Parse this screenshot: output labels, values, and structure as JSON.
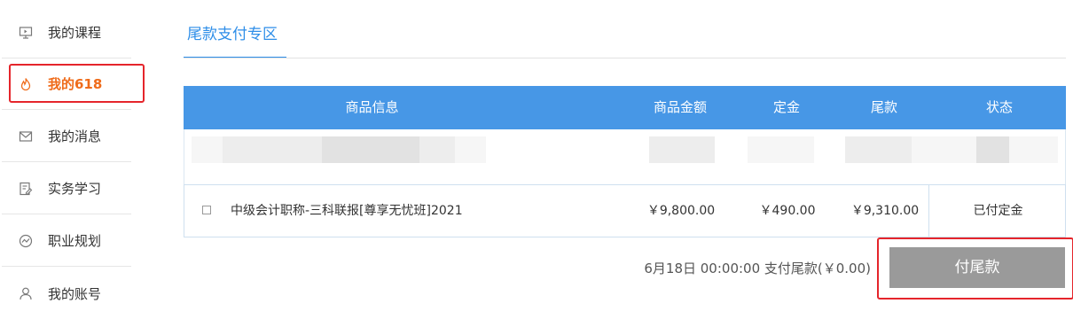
{
  "sidebar": {
    "items": [
      {
        "label": "我的课程",
        "icon": "monitor-icon"
      },
      {
        "label": "我的618",
        "icon": "flame-icon",
        "active": true
      },
      {
        "label": "我的消息",
        "icon": "mail-icon"
      },
      {
        "label": "实务学习",
        "icon": "edit-doc-icon"
      },
      {
        "label": "职业规划",
        "icon": "trend-circle-icon"
      },
      {
        "label": "我的账号",
        "icon": "user-icon"
      }
    ]
  },
  "tabs": [
    {
      "label": "尾款支付专区"
    }
  ],
  "table": {
    "headers": [
      "商品信息",
      "商品金额",
      "定金",
      "尾款",
      "状态"
    ],
    "rows": [
      {
        "name": "中级会计职称-三科联报[尊享无忧班]2021",
        "price": "￥9,800.00",
        "deposit": "￥490.00",
        "balance": "￥9,310.00",
        "status": "已付定金"
      }
    ]
  },
  "footer": {
    "deadline_text": "6月18日 00:00:00 支付尾款(￥0.00)",
    "pay_button": "付尾款"
  },
  "colors": {
    "accent": "#2e8ee8",
    "header_bg": "#4797e6",
    "active": "#ef6b1a",
    "highlight": "#e5252b",
    "button_disabled": "#9a9a9a"
  }
}
